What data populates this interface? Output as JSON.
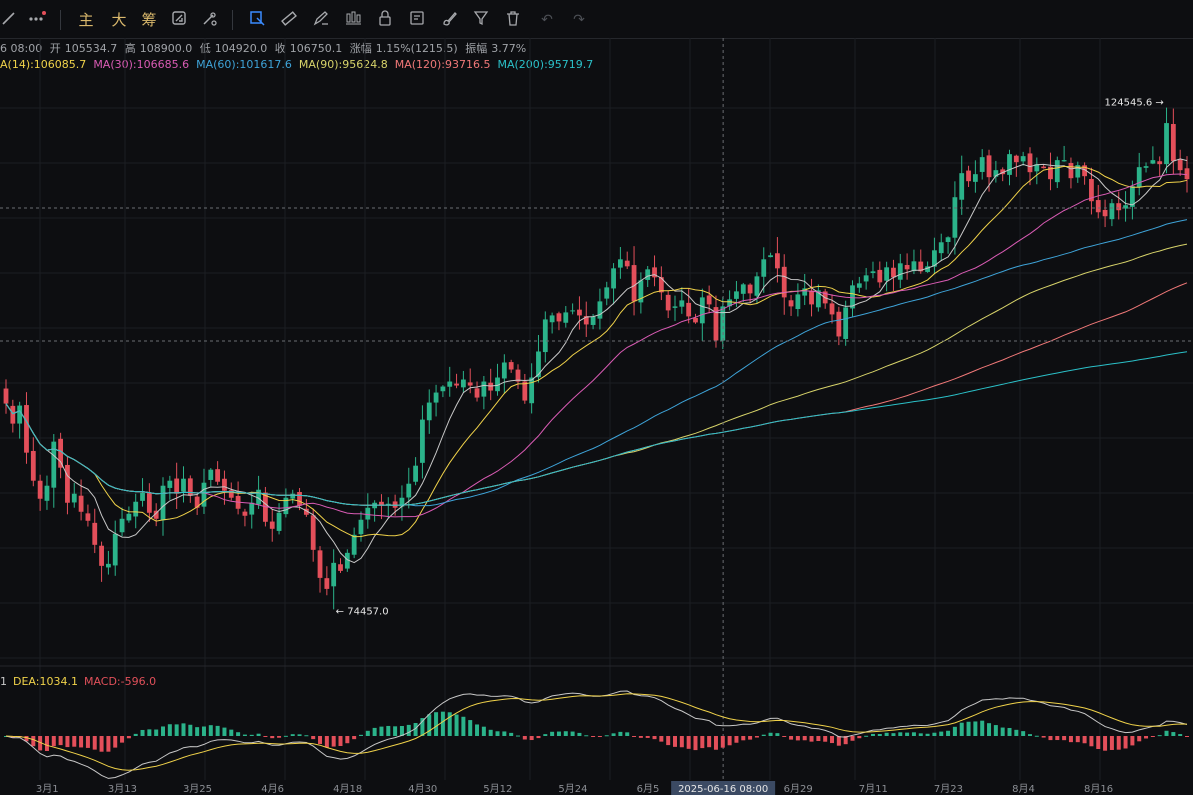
{
  "toolbar": {
    "items": [
      {
        "name": "line-tool-icon",
        "glyph": "／"
      },
      {
        "name": "more-icon",
        "glyph": "•••"
      },
      {
        "name": "indicator-main",
        "label": "主"
      },
      {
        "name": "indicator-big",
        "label": "大"
      },
      {
        "name": "indicator-chip",
        "label": "筹"
      },
      {
        "name": "drawing-sync-icon",
        "glyph": ""
      },
      {
        "name": "drawing-settings-icon",
        "glyph": ""
      },
      {
        "name": "select-frame-icon",
        "glyph": ""
      },
      {
        "name": "ruler-icon",
        "glyph": ""
      },
      {
        "name": "pen-icon",
        "glyph": ""
      },
      {
        "name": "candles-icon",
        "glyph": ""
      },
      {
        "name": "lock-icon",
        "glyph": ""
      },
      {
        "name": "note-icon",
        "glyph": ""
      },
      {
        "name": "brush-icon",
        "glyph": ""
      },
      {
        "name": "filter-icon",
        "glyph": ""
      },
      {
        "name": "trash-icon",
        "glyph": ""
      },
      {
        "name": "undo-icon",
        "glyph": "↶"
      },
      {
        "name": "redo-icon",
        "glyph": "↷"
      }
    ]
  },
  "ohlc": {
    "date": "6 08:00",
    "open_label": "开",
    "open": "105534.7",
    "high_label": "高",
    "high": "108900.0",
    "low_label": "低",
    "low": "104920.0",
    "close_label": "收",
    "close": "106750.1",
    "change_label": "涨幅",
    "change": "1.15%(1215.5)",
    "amp_label": "振幅",
    "amp": "3.77%"
  },
  "ma": [
    {
      "label": "A(14):106085.7",
      "color": "#f0d24a"
    },
    {
      "label": "MA(30):106685.6",
      "color": "#d95bb4"
    },
    {
      "label": "MA(60):101617.6",
      "color": "#3ea3d8"
    },
    {
      "label": "MA(90):95624.8",
      "color": "#d7d36a"
    },
    {
      "label": "MA(120):93716.5",
      "color": "#f07878"
    },
    {
      "label": "MA(200):95719.7",
      "color": "#2bc0c8"
    }
  ],
  "macd": [
    {
      "label": "1",
      "color": "#c9c9c9"
    },
    {
      "label": "DEA:1034.1",
      "color": "#f0d24a"
    },
    {
      "label": "MACD:-596.0",
      "color": "#e0505a"
    }
  ],
  "colors": {
    "up": "#2bb38a",
    "down": "#e34f5a",
    "bg": "#0d0e11",
    "grid": "#1c1e22"
  },
  "chart_data": {
    "type": "candlestick",
    "price_range": [
      71000,
      127500
    ],
    "annotations": {
      "high": "124545.6",
      "low": "74457.0"
    },
    "x_ticks": [
      "3月1",
      "3月13",
      "3月25",
      "4月6",
      "4月18",
      "4月30",
      "5月12",
      "5月24",
      "6月5",
      "2025-06-16 08:00",
      "6月29",
      "7月11",
      "7月23",
      "8月4",
      "8月16"
    ],
    "crosshair_label": "2025-06-16 08:00",
    "close": [
      95000,
      93000,
      94800,
      90100,
      87300,
      85500,
      86800,
      91200,
      88600,
      85100,
      86000,
      84200,
      83300,
      80900,
      78800,
      79000,
      82000,
      83500,
      84000,
      85200,
      86100,
      84100,
      83500,
      86800,
      87300,
      86000,
      87500,
      85800,
      84600,
      87100,
      88400,
      87200,
      86300,
      85600,
      84500,
      83800,
      85100,
      86400,
      83200,
      82500,
      84100,
      85600,
      86000,
      84800,
      83900,
      80400,
      77600,
      76500,
      79100,
      78300,
      80100,
      81900,
      83400,
      84600,
      85100,
      84800,
      85000,
      84600,
      85600,
      87000,
      88800,
      93400,
      95100,
      96100,
      96700,
      97200,
      96800,
      97400,
      96800,
      95600,
      97200,
      96300,
      97600,
      99100,
      98400,
      97200,
      95300,
      97600,
      100200,
      103400,
      103800,
      103200,
      104100,
      104300,
      103800,
      102900,
      103700,
      105200,
      106600,
      108500,
      109400,
      108700,
      105200,
      107300,
      108400,
      107600,
      106100,
      104300,
      104700,
      105300,
      103700,
      103100,
      105600,
      104900,
      101300,
      104700,
      105400,
      106200,
      106900,
      106000,
      107700,
      109400,
      109800,
      108500,
      105600,
      104700,
      105900,
      106500,
      104900,
      106300,
      105000,
      103900,
      101700,
      104600,
      106800,
      107000,
      107800,
      108200,
      107100,
      108600,
      107600,
      109000,
      108400,
      109200,
      108200,
      108700,
      110300,
      111100,
      111600,
      115600,
      118000,
      117200,
      117900,
      119600,
      117600,
      118300,
      117900,
      119900,
      119100,
      119700,
      118100,
      118900,
      118500,
      117400,
      119300,
      119300,
      117500,
      118800,
      117700,
      115200,
      114100,
      113700,
      115000,
      114300,
      114800,
      116700,
      118600,
      118700,
      119300,
      118900,
      123000,
      119200,
      118300,
      117400
    ]
  }
}
